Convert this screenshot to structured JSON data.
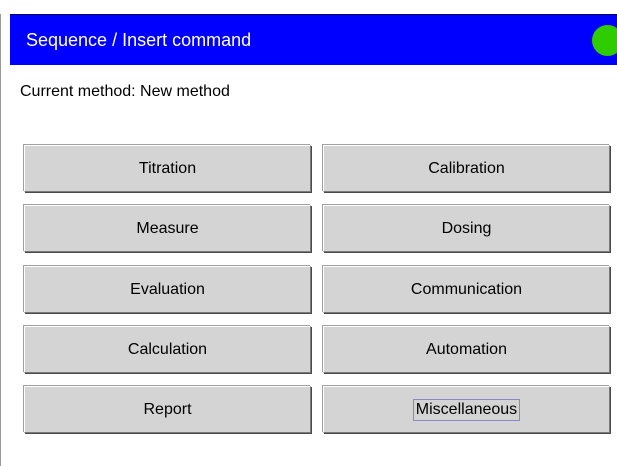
{
  "header": {
    "title": "Sequence / Insert command",
    "status_color": "#2ecc00"
  },
  "current_method": "Current method: New method",
  "commands": [
    {
      "label": "Titration"
    },
    {
      "label": "Calibration"
    },
    {
      "label": "Measure"
    },
    {
      "label": "Dosing"
    },
    {
      "label": "Evaluation"
    },
    {
      "label": "Communication"
    },
    {
      "label": "Calculation"
    },
    {
      "label": "Automation"
    },
    {
      "label": "Report"
    },
    {
      "label": "Miscellaneous",
      "focused": true
    }
  ],
  "colors": {
    "title_bar": "#0000ff",
    "button_face": "#d4d4d4"
  }
}
